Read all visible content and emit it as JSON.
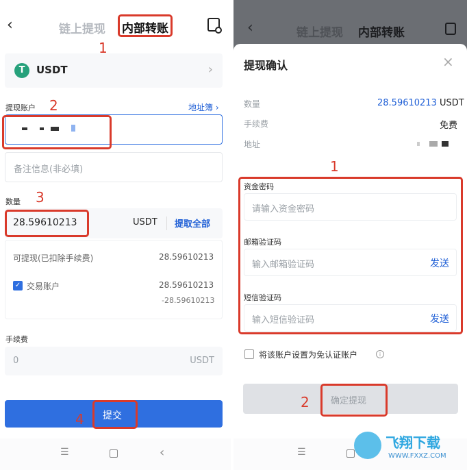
{
  "left": {
    "tabs": {
      "onchain": "链上提现",
      "internal": "内部转账"
    },
    "coin": {
      "name": "USDT",
      "logo_glyph": "T"
    },
    "account": {
      "label": "提现账户",
      "addressbook": "地址簿 ›"
    },
    "memo_placeholder": "备注信息(非必填)",
    "amount": {
      "label": "数量",
      "value": "28.59610213",
      "unit": "USDT",
      "all": "提取全部"
    },
    "available": {
      "label": "可提现(已扣除手续费)",
      "value": "28.59610213"
    },
    "trade_account": {
      "label": "交易账户",
      "value": "28.59610213",
      "deduct": "-28.59610213"
    },
    "fee": {
      "label": "手续费",
      "value": "0",
      "unit": "USDT"
    },
    "submit": "提交",
    "nums": [
      "1",
      "2",
      "3",
      "4"
    ]
  },
  "right": {
    "tabs": {
      "onchain": "链上提现",
      "internal": "内部转账"
    },
    "title": "提现确认",
    "rows": [
      {
        "label": "数量",
        "value": "28.59610213",
        "unit": "USDT"
      },
      {
        "label": "手续费",
        "value": "免费"
      },
      {
        "label": "地址",
        "value": ""
      }
    ],
    "fund_pwd": {
      "label": "资金密码",
      "placeholder": "请输入资金密码"
    },
    "email_code": {
      "label": "邮箱验证码",
      "placeholder": "输入邮箱验证码",
      "send": "发送"
    },
    "sms_code": {
      "label": "短信验证码",
      "placeholder": "输入短信验证码",
      "send": "发送"
    },
    "exempt": "将该账户设置为免认证账户",
    "confirm": "确定提现",
    "nums": [
      "1",
      "2"
    ],
    "watermark": {
      "brand": "飞翔下载",
      "url": "WWW.FXXZ.COM"
    }
  },
  "colors": {
    "accent": "#1f5fd6",
    "red": "#d93a2b",
    "tether": "#26a17b"
  }
}
